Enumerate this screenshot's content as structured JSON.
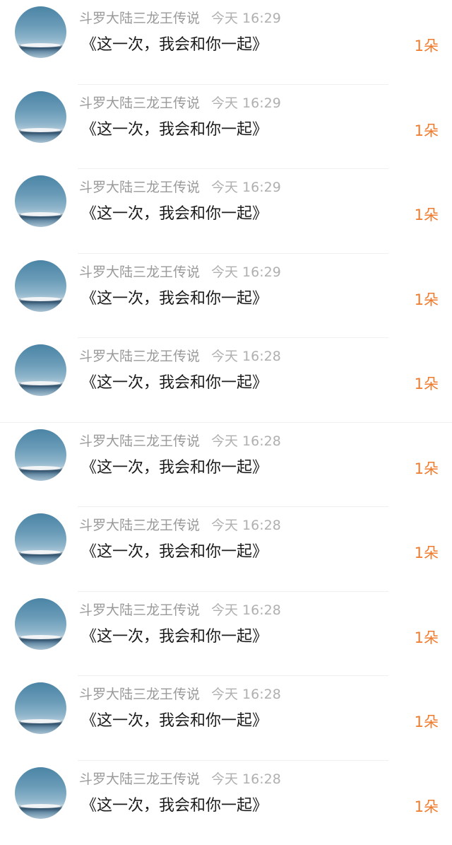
{
  "comments": [
    {
      "user": "斗罗大陆三龙王传说",
      "time": "今天 16:29",
      "text": "《这一次，我会和你一起》",
      "count": "1朵"
    },
    {
      "user": "斗罗大陆三龙王传说",
      "time": "今天 16:29",
      "text": "《这一次，我会和你一起》",
      "count": "1朵"
    },
    {
      "user": "斗罗大陆三龙王传说",
      "time": "今天 16:29",
      "text": "《这一次，我会和你一起》",
      "count": "1朵"
    },
    {
      "user": "斗罗大陆三龙王传说",
      "time": "今天 16:29",
      "text": "《这一次，我会和你一起》",
      "count": "1朵"
    },
    {
      "user": "斗罗大陆三龙王传说",
      "time": "今天 16:28",
      "text": "《这一次，我会和你一起》",
      "count": "1朵"
    },
    {
      "user": "斗罗大陆三龙王传说",
      "time": "今天 16:28",
      "text": "《这一次，我会和你一起》",
      "count": "1朵"
    },
    {
      "user": "斗罗大陆三龙王传说",
      "time": "今天 16:28",
      "text": "《这一次，我会和你一起》",
      "count": "1朵"
    },
    {
      "user": "斗罗大陆三龙王传说",
      "time": "今天 16:28",
      "text": "《这一次，我会和你一起》",
      "count": "1朵"
    },
    {
      "user": "斗罗大陆三龙王传说",
      "time": "今天 16:28",
      "text": "《这一次，我会和你一起》",
      "count": "1朵"
    },
    {
      "user": "斗罗大陆三龙王传说",
      "time": "今天 16:28",
      "text": "《这一次，我会和你一起》",
      "count": "1朵"
    }
  ],
  "colors": {
    "count": "#f07b2c",
    "name": "#9a9a9a",
    "message": "#1c1c1c"
  }
}
